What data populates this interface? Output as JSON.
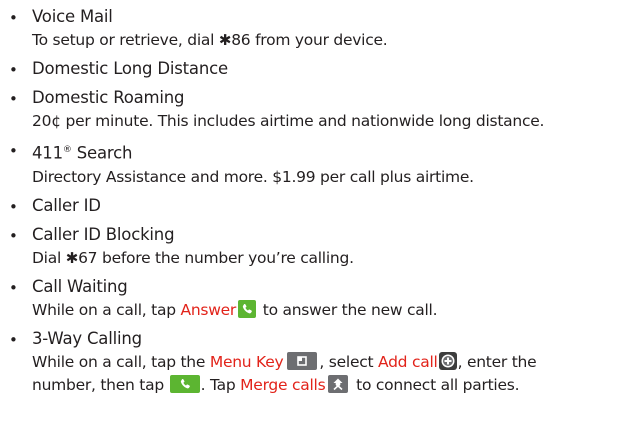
{
  "items": {
    "voicemail": {
      "title": "Voice Mail",
      "desc_before": "To setup or retrieve, dial ",
      "star": "✱",
      "code": "86",
      "desc_after": " from your device."
    },
    "long_distance": {
      "title": "Domestic Long Distance"
    },
    "roaming": {
      "title": "Domestic Roaming",
      "desc": "20¢ per minute. This includes airtime and nationwide long distance."
    },
    "search411": {
      "title_num": "411",
      "title_reg": "®",
      "title_rest": " Search",
      "desc": "Directory Assistance and more. $1.99 per call plus airtime."
    },
    "caller_id": {
      "title": "Caller ID"
    },
    "caller_id_block": {
      "title": "Caller ID Blocking",
      "desc_before": "Dial ",
      "star": "✱",
      "code": "67",
      "desc_after": " before the number you’re calling."
    },
    "call_waiting": {
      "title": "Call Waiting",
      "desc_before": "While on a call, tap ",
      "answer": "Answer",
      "desc_after": " to answer the new call."
    },
    "three_way": {
      "title": "3-Way Calling",
      "line1_a": "While on a call, tap the ",
      "menu_key": "Menu Key",
      "line1_b": ", select ",
      "add_call": "Add call",
      "line1_c": ", enter the",
      "line2_a": "number, then tap ",
      "line2_b": ". Tap ",
      "merge_calls": "Merge calls",
      "line2_c": " to connect all parties."
    }
  },
  "bullet_char": "•",
  "colors": {
    "text": "#231f20",
    "highlight": "#e2231a",
    "phone_green": "#5cb531",
    "icon_gray": "#6d6e71"
  },
  "icons": {
    "answer": "phone-answer-icon",
    "menu_key": "menu-key-icon",
    "add_call": "add-call-icon",
    "dial": "phone-dial-icon",
    "merge": "merge-calls-icon"
  }
}
